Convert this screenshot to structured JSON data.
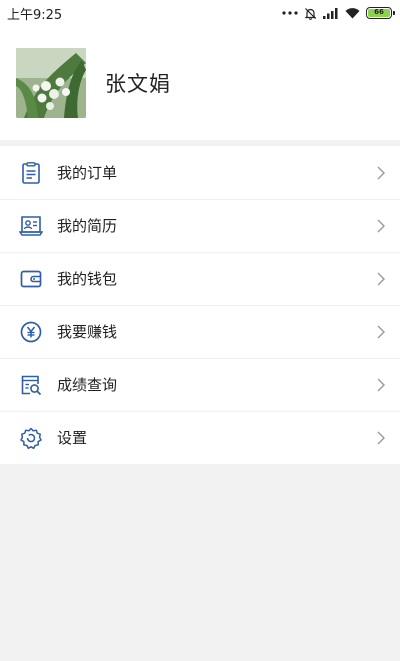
{
  "status_bar": {
    "time": "上午9:25",
    "battery": "66"
  },
  "profile": {
    "user_name": "张文娟"
  },
  "menu": {
    "items": [
      {
        "label": "我的订单",
        "icon": "order-list-icon"
      },
      {
        "label": "我的简历",
        "icon": "resume-icon"
      },
      {
        "label": "我的钱包",
        "icon": "wallet-icon"
      },
      {
        "label": "我要赚钱",
        "icon": "yuan-coin-icon"
      },
      {
        "label": "成绩查询",
        "icon": "score-search-icon"
      },
      {
        "label": "设置",
        "icon": "settings-gear-icon"
      }
    ]
  },
  "colors": {
    "accent": "#2f5da8",
    "background": "#f2f2f2",
    "card": "#ffffff",
    "battery": "#8fd14f"
  }
}
